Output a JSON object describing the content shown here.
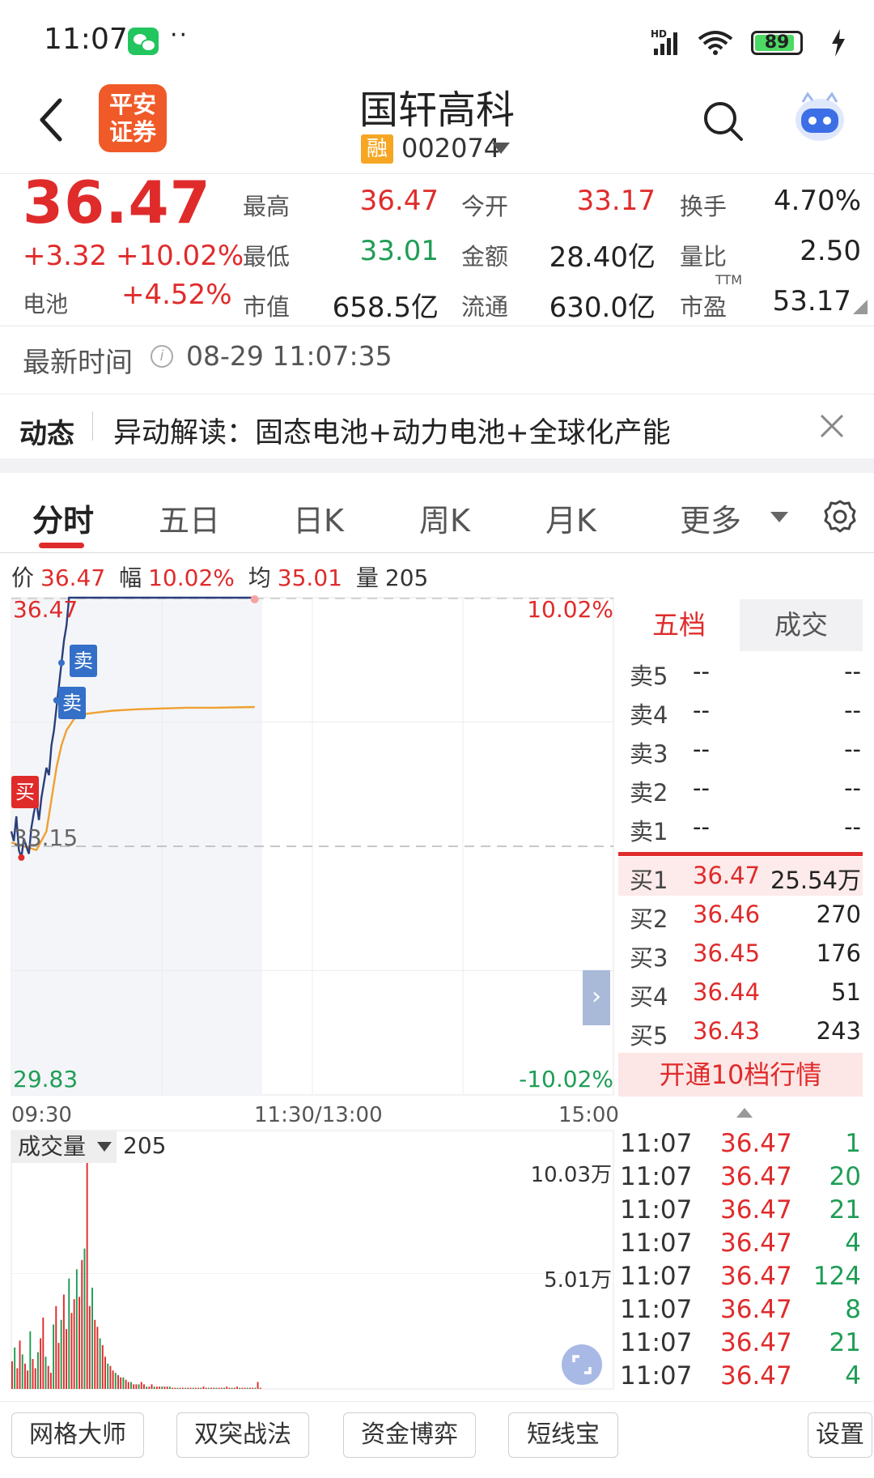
{
  "status_bar": {
    "time": "11:07",
    "dots": "··",
    "battery": "89",
    "battery_level_pct": 89,
    "icons": [
      "wechat-icon",
      "hd-signal-icon",
      "wifi-icon",
      "battery-icon",
      "charging-icon"
    ]
  },
  "header": {
    "brand_logo": "平安证券",
    "stock_name": "国轩高科",
    "margin_badge": "融",
    "stock_code": "002074"
  },
  "quote": {
    "price": "36.47",
    "change": "+3.32  +10.02%",
    "sector_label": "电池",
    "sector_change": "+4.52%",
    "fields": [
      {
        "label": "最高",
        "value": "36.47",
        "tone": "red"
      },
      {
        "label": "今开",
        "value": "33.17",
        "tone": "red"
      },
      {
        "label": "换手",
        "value": "4.70%",
        "tone": "dark"
      },
      {
        "label": "最低",
        "value": "33.01",
        "tone": "green"
      },
      {
        "label": "金额",
        "value": "28.40亿",
        "tone": "dark"
      },
      {
        "label": "量比",
        "value": "2.50",
        "tone": "dark"
      },
      {
        "label": "市值",
        "value": "658.5亿",
        "tone": "dark"
      },
      {
        "label": "流通",
        "value": "630.0亿",
        "tone": "dark"
      },
      {
        "label": "市盈",
        "value": "53.17",
        "tone": "dark"
      }
    ],
    "ttm": "TTM"
  },
  "update": {
    "label": "最新时间",
    "time": "08-29 11:07:35"
  },
  "news": {
    "tag": "动态",
    "text": "异动解读：固态电池+动力电池+全球化产能"
  },
  "tabs": [
    "分时",
    "五日",
    "日K",
    "周K",
    "月K",
    "更多"
  ],
  "info_line": {
    "price_label": "价",
    "price": "36.47",
    "amp_label": "幅",
    "amp": "10.02%",
    "avg_label": "均",
    "avg": "35.01",
    "vol_label": "量",
    "vol": "205"
  },
  "chart": {
    "y_top": "36.47",
    "y_mid": "33.15",
    "y_bottom": "29.83",
    "pct_top": "10.02%",
    "pct_bottom": "-10.02%",
    "x_ticks": [
      "09:30",
      "11:30/13:00",
      "15:00"
    ],
    "markers": [
      {
        "label": "买",
        "type": "buy"
      },
      {
        "label": "卖",
        "type": "sell"
      },
      {
        "label": "卖",
        "type": "sell"
      }
    ],
    "expand_arrow": "›"
  },
  "chart_data": {
    "type": "line",
    "title": "",
    "ylim": [
      29.83,
      36.47
    ],
    "reference_price": 33.15,
    "series": [
      {
        "name": "价",
        "x_minutes": [
          0,
          1,
          2,
          3,
          4,
          5,
          6,
          7,
          8,
          9,
          10,
          11,
          12,
          13,
          14,
          15,
          16,
          17,
          18,
          19,
          20,
          21,
          22,
          23,
          24,
          25,
          26,
          27,
          28,
          29,
          30,
          40,
          60,
          80,
          97
        ],
        "values": [
          33.35,
          33.22,
          33.55,
          33.1,
          33.0,
          33.25,
          33.15,
          33.05,
          33.4,
          33.6,
          33.75,
          33.5,
          33.8,
          34.0,
          34.2,
          34.1,
          34.5,
          34.7,
          35.0,
          35.3,
          35.6,
          35.9,
          36.1,
          36.47,
          36.47,
          36.47,
          36.47,
          36.47,
          36.47,
          36.47,
          36.47,
          36.47,
          36.47,
          36.47,
          36.47
        ]
      },
      {
        "name": "均",
        "x_minutes": [
          0,
          5,
          10,
          14,
          18,
          20,
          22,
          25,
          30,
          40,
          50,
          60,
          70,
          80,
          97
        ],
        "values": [
          33.2,
          33.15,
          33.1,
          33.35,
          34.2,
          34.5,
          34.7,
          34.85,
          34.92,
          34.96,
          34.98,
          34.99,
          35.0,
          35.0,
          35.01
        ]
      }
    ],
    "volume": {
      "label": "成交量",
      "current": "205",
      "axis_top": "10.03万",
      "axis_mid": "5.01万",
      "ylim": [
        0,
        10.03
      ],
      "values": [
        1.2,
        1.8,
        0.9,
        2.1,
        1.5,
        1.1,
        0.8,
        2.5,
        1.3,
        0.9,
        1.6,
        2.2,
        3.1,
        1.4,
        1.0,
        0.7,
        2.8,
        3.6,
        2.0,
        3.0,
        4.1,
        2.6,
        4.8,
        3.3,
        3.9,
        5.2,
        4.0,
        5.6,
        6.1,
        10.03,
        3.6,
        4.4,
        3.0,
        2.7,
        2.2,
        1.9,
        1.4,
        1.1,
        1.0,
        0.8,
        0.7,
        0.6,
        0.5,
        0.5,
        0.4,
        0.3,
        0.3,
        0.2,
        0.2,
        0.2,
        0.3,
        0.2,
        0.1,
        0.1,
        0.2,
        0.1,
        0.1,
        0.1,
        0.1,
        0.1,
        0.1,
        0.1,
        0.05,
        0.05,
        0.05,
        0.05,
        0.05,
        0.05,
        0.05,
        0.05,
        0.05,
        0.05,
        0.05,
        0.05,
        0.1,
        0.05,
        0.05,
        0.05,
        0.05,
        0.05,
        0.05,
        0.05,
        0.05,
        0.1,
        0.05,
        0.05,
        0.05,
        0.1,
        0.05,
        0.05,
        0.05,
        0.05,
        0.05,
        0.05,
        0.05,
        0.3,
        0.05
      ]
    }
  },
  "order_book": {
    "tabs": [
      "五档",
      "成交"
    ],
    "sell": [
      {
        "label": "卖5",
        "price": "--",
        "vol": "--"
      },
      {
        "label": "卖4",
        "price": "--",
        "vol": "--"
      },
      {
        "label": "卖3",
        "price": "--",
        "vol": "--"
      },
      {
        "label": "卖2",
        "price": "--",
        "vol": "--"
      },
      {
        "label": "卖1",
        "price": "--",
        "vol": "--"
      }
    ],
    "buy": [
      {
        "label": "买1",
        "price": "36.47",
        "vol": "25.54万"
      },
      {
        "label": "买2",
        "price": "36.46",
        "vol": "270"
      },
      {
        "label": "买3",
        "price": "36.45",
        "vol": "176"
      },
      {
        "label": "买4",
        "price": "36.44",
        "vol": "51"
      },
      {
        "label": "买5",
        "price": "36.43",
        "vol": "243"
      }
    ],
    "open10": "开通10档行情"
  },
  "ticks": [
    {
      "time": "11:07",
      "price": "36.47",
      "vol": "1"
    },
    {
      "time": "11:07",
      "price": "36.47",
      "vol": "20"
    },
    {
      "time": "11:07",
      "price": "36.47",
      "vol": "21"
    },
    {
      "time": "11:07",
      "price": "36.47",
      "vol": "4"
    },
    {
      "time": "11:07",
      "price": "36.47",
      "vol": "124"
    },
    {
      "time": "11:07",
      "price": "36.47",
      "vol": "8"
    },
    {
      "time": "11:07",
      "price": "36.47",
      "vol": "21"
    },
    {
      "time": "11:07",
      "price": "36.47",
      "vol": "4"
    }
  ],
  "tools": [
    "网格大师",
    "双突战法",
    "资金博弈",
    "短线宝",
    "设置"
  ],
  "colors": {
    "up": "#e02b2b",
    "down": "#1f9d55",
    "price_line": "#2a3f7a",
    "avg_line": "#f0a030",
    "brand": "#f05a28"
  }
}
